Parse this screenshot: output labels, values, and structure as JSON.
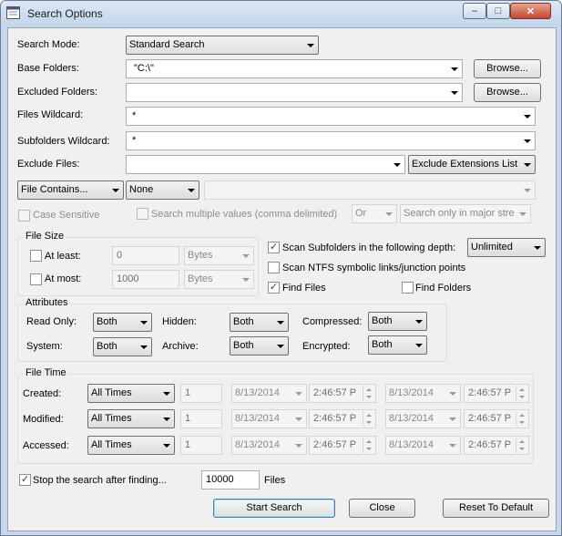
{
  "window": {
    "title": "Search Options",
    "min_glyph": "‒",
    "max_glyph": "□",
    "close_glyph": "✕"
  },
  "labels": {
    "search_mode": "Search Mode:",
    "base_folders": "Base Folders:",
    "excluded_folders": "Excluded Folders:",
    "files_wildcard": "Files Wildcard:",
    "subfolders_wildcard": "Subfolders Wildcard:",
    "exclude_files": "Exclude Files:"
  },
  "fields": {
    "search_mode": "Standard Search",
    "base_folders": "\"C:\\\"",
    "excluded_folders": "",
    "files_wildcard": "*",
    "subfolders_wildcard": "*",
    "exclude_files": "",
    "exclude_extensions": "Exclude Extensions List",
    "file_contains": "File Contains...",
    "contains_type": "None",
    "contains_value": ""
  },
  "buttons": {
    "browse": "Browse...",
    "start_search": "Start Search",
    "close": "Close",
    "reset": "Reset To Default"
  },
  "options_row": {
    "case_sensitive": "Case Sensitive",
    "multiple_values": "Search multiple values (comma delimited)",
    "or_value": "Or",
    "streams_value": "Search only in major stre"
  },
  "file_size": {
    "title": "File Size",
    "at_least": "At least:",
    "at_most": "At most:",
    "at_least_value": "0",
    "at_most_value": "1000",
    "unit_least": "Bytes",
    "unit_most": "Bytes"
  },
  "scan": {
    "subfolders": "Scan Subfolders in the following depth:",
    "depth": "Unlimited",
    "ntfs": "Scan NTFS symbolic links/junction points",
    "find_files": "Find Files",
    "find_folders": "Find Folders"
  },
  "attributes": {
    "title": "Attributes",
    "read_only": "Read Only:",
    "hidden": "Hidden:",
    "compressed": "Compressed:",
    "system": "System:",
    "archive": "Archive:",
    "encrypted": "Encrypted:",
    "read_only_value": "Both",
    "hidden_value": "Both",
    "compressed_value": "Both",
    "system_value": "Both",
    "archive_value": "Both",
    "encrypted_value": "Both"
  },
  "file_time": {
    "title": "File Time",
    "rows": [
      {
        "label": "Created:",
        "mode": "All Times",
        "num": "1",
        "date1": "8/13/2014",
        "time1": "2:46:57 P",
        "date2": "8/13/2014",
        "time2": "2:46:57 P"
      },
      {
        "label": "Modified:",
        "mode": "All Times",
        "num": "1",
        "date1": "8/13/2014",
        "time1": "2:46:57 P",
        "date2": "8/13/2014",
        "time2": "2:46:57 P"
      },
      {
        "label": "Accessed:",
        "mode": "All Times",
        "num": "1",
        "date1": "8/13/2014",
        "time1": "2:46:57 P",
        "date2": "8/13/2014",
        "time2": "2:46:57 P"
      }
    ]
  },
  "stop": {
    "label": "Stop the search after finding...",
    "value": "10000",
    "suffix": "Files"
  },
  "colors": {
    "title_bar": "#c7d8ec",
    "dialog_bg": "#f0f0f0",
    "close_button": "#c5452c"
  }
}
